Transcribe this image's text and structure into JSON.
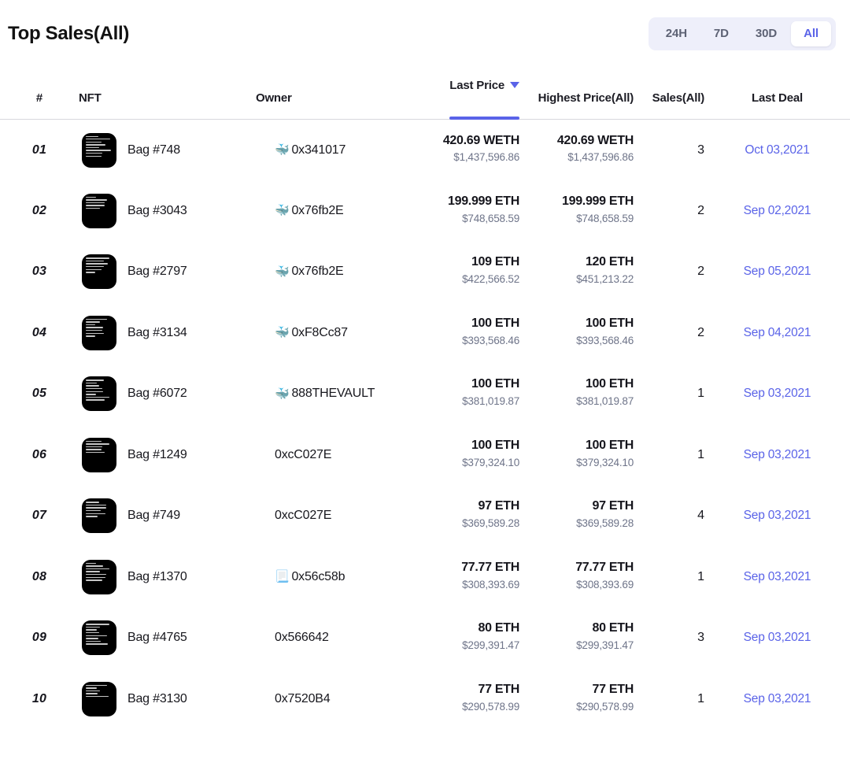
{
  "header": {
    "title": "Top Sales(All)",
    "range_filters": [
      {
        "label": "24H",
        "active": false
      },
      {
        "label": "7D",
        "active": false
      },
      {
        "label": "30D",
        "active": false
      },
      {
        "label": "All",
        "active": true
      }
    ]
  },
  "colors": {
    "accent": "#5a63e8",
    "switch_bg": "#eeeffa",
    "text_primary": "#15151c",
    "text_muted": "#6e7489",
    "thumb_bg": "#000000"
  },
  "table": {
    "columns": [
      {
        "key": "rank",
        "label": "#"
      },
      {
        "key": "nft",
        "label": "NFT"
      },
      {
        "key": "owner",
        "label": "Owner"
      },
      {
        "key": "last",
        "label": "Last Price",
        "sorted": true,
        "sort_icon": "caret-down-icon"
      },
      {
        "key": "high",
        "label": "Highest Price(All)"
      },
      {
        "key": "sales",
        "label": "Sales(All)"
      },
      {
        "key": "deal",
        "label": "Last Deal"
      }
    ],
    "rows": [
      {
        "rank": "01",
        "nft": "Bag #748",
        "owner": "0x341017",
        "owner_icon": "whale-icon",
        "owner_emoji": "🐳",
        "last_price": "420.69 WETH",
        "last_price_usd": "$1,437,596.86",
        "highest_price": "420.69 WETH",
        "highest_price_usd": "$1,437,596.86",
        "sales": "3",
        "last_deal": "Oct 03,2021"
      },
      {
        "rank": "02",
        "nft": "Bag #3043",
        "owner": "0x76fb2E",
        "owner_icon": "whale-icon",
        "owner_emoji": "🐳",
        "last_price": "199.999 ETH",
        "last_price_usd": "$748,658.59",
        "highest_price": "199.999 ETH",
        "highest_price_usd": "$748,658.59",
        "sales": "2",
        "last_deal": "Sep 02,2021"
      },
      {
        "rank": "03",
        "nft": "Bag #2797",
        "owner": "0x76fb2E",
        "owner_icon": "whale-icon",
        "owner_emoji": "🐳",
        "last_price": "109 ETH",
        "last_price_usd": "$422,566.52",
        "highest_price": "120 ETH",
        "highest_price_usd": "$451,213.22",
        "sales": "2",
        "last_deal": "Sep 05,2021"
      },
      {
        "rank": "04",
        "nft": "Bag #3134",
        "owner": "0xF8Cc87",
        "owner_icon": "whale-icon",
        "owner_emoji": "🐳",
        "last_price": "100 ETH",
        "last_price_usd": "$393,568.46",
        "highest_price": "100 ETH",
        "highest_price_usd": "$393,568.46",
        "sales": "2",
        "last_deal": "Sep 04,2021"
      },
      {
        "rank": "05",
        "nft": "Bag #6072",
        "owner": "888THEVAULT",
        "owner_icon": "whale-icon",
        "owner_emoji": "🐳",
        "last_price": "100 ETH",
        "last_price_usd": "$381,019.87",
        "highest_price": "100 ETH",
        "highest_price_usd": "$381,019.87",
        "sales": "1",
        "last_deal": "Sep 03,2021"
      },
      {
        "rank": "06",
        "nft": "Bag #1249",
        "owner": "0xcC027E",
        "owner_icon": "none",
        "owner_emoji": "",
        "last_price": "100 ETH",
        "last_price_usd": "$379,324.10",
        "highest_price": "100 ETH",
        "highest_price_usd": "$379,324.10",
        "sales": "1",
        "last_deal": "Sep 03,2021"
      },
      {
        "rank": "07",
        "nft": "Bag #749",
        "owner": "0xcC027E",
        "owner_icon": "none",
        "owner_emoji": "",
        "last_price": "97 ETH",
        "last_price_usd": "$369,589.28",
        "highest_price": "97 ETH",
        "highest_price_usd": "$369,589.28",
        "sales": "4",
        "last_deal": "Sep 03,2021"
      },
      {
        "rank": "08",
        "nft": "Bag #1370",
        "owner": "0x56c58b",
        "owner_icon": "page-icon",
        "owner_emoji": "📃",
        "last_price": "77.77 ETH",
        "last_price_usd": "$308,393.69",
        "highest_price": "77.77 ETH",
        "highest_price_usd": "$308,393.69",
        "sales": "1",
        "last_deal": "Sep 03,2021"
      },
      {
        "rank": "09",
        "nft": "Bag #4765",
        "owner": "0x566642",
        "owner_icon": "none",
        "owner_emoji": "",
        "last_price": "80 ETH",
        "last_price_usd": "$299,391.47",
        "highest_price": "80 ETH",
        "highest_price_usd": "$299,391.47",
        "sales": "3",
        "last_deal": "Sep 03,2021"
      },
      {
        "rank": "10",
        "nft": "Bag #3130",
        "owner": "0x7520B4",
        "owner_icon": "none",
        "owner_emoji": "",
        "last_price": "77 ETH",
        "last_price_usd": "$290,578.99",
        "highest_price": "77 ETH",
        "highest_price_usd": "$290,578.99",
        "sales": "1",
        "last_deal": "Sep 03,2021"
      }
    ]
  }
}
